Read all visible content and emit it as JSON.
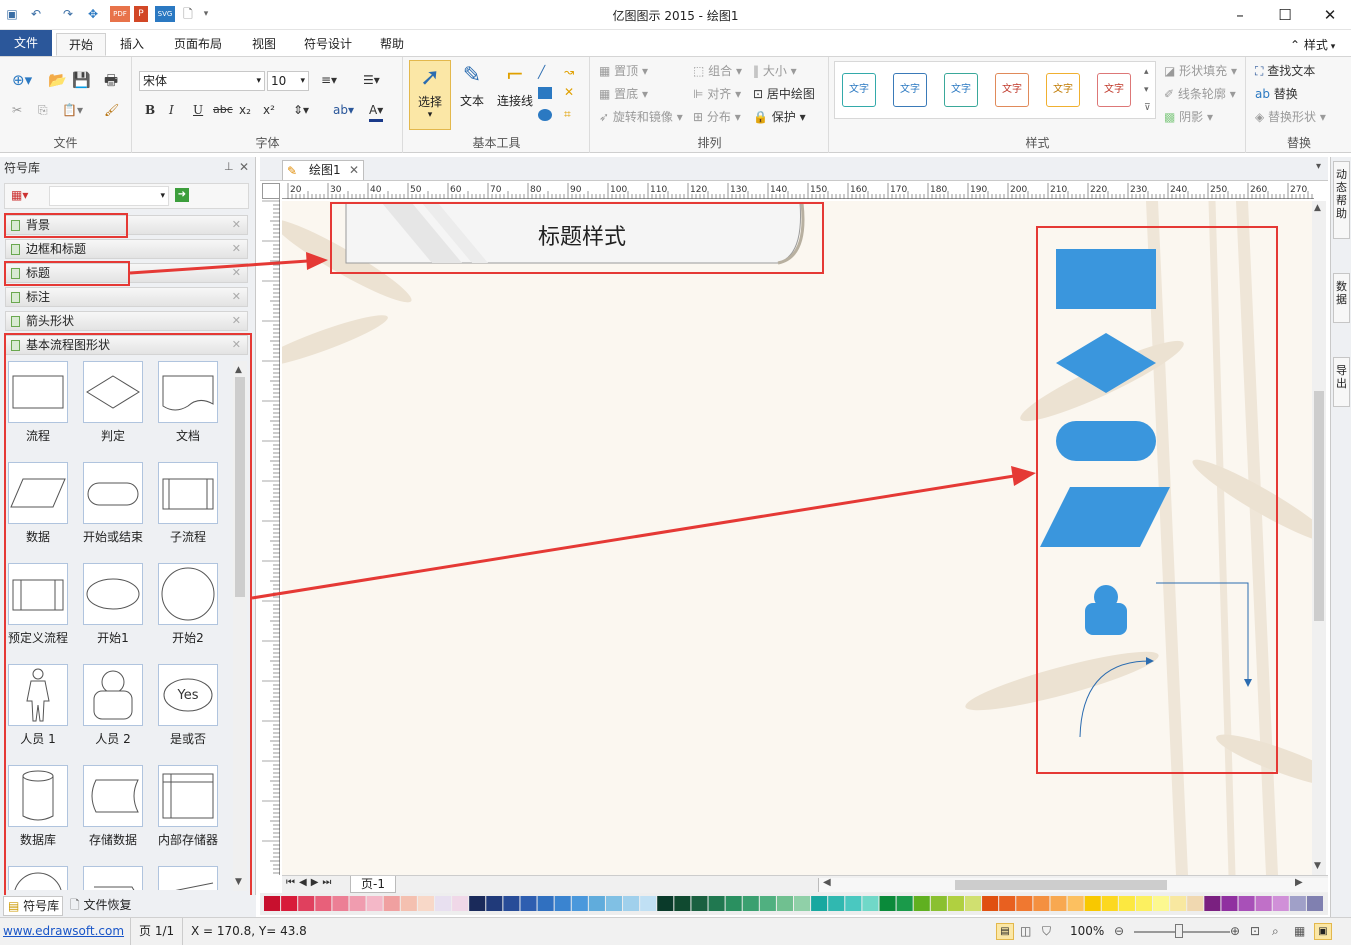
{
  "window": {
    "title": "亿图图示 2015 - 绘图1"
  },
  "quick_access": {
    "pdf": "PDF",
    "ppt": "P",
    "svg": "SVG"
  },
  "tabs": [
    {
      "label": "文件"
    },
    {
      "label": "开始"
    },
    {
      "label": "插入"
    },
    {
      "label": "页面布局"
    },
    {
      "label": "视图"
    },
    {
      "label": "符号设计"
    },
    {
      "label": "帮助"
    }
  ],
  "ribbon_right": {
    "styles_label": "样式"
  },
  "ribbon": {
    "file_group": {
      "label": "文件"
    },
    "font_group": {
      "label": "字体",
      "font_name": "宋体",
      "font_size": "10",
      "bold": "B",
      "italic": "I",
      "underline": "U",
      "strike": "abc",
      "sub": "x₂",
      "sup": "x²",
      "color": "A"
    },
    "tools_group": {
      "label": "基本工具",
      "select": "选择",
      "text": "文本",
      "connector": "连接线"
    },
    "arrange_group": {
      "label": "排列",
      "top": "置顶",
      "bottom": "置底",
      "rotate": "旋转和镜像",
      "group": "组合",
      "align": "对齐",
      "distribute": "分布",
      "size": "大小",
      "center": "居中绘图",
      "protect": "保护"
    },
    "style_group": {
      "label": "样式",
      "sample": "文字",
      "fill": "形状填充",
      "line": "线条轮廓",
      "shadow": "阴影"
    },
    "replace_group": {
      "label": "替换",
      "find": "查找文本",
      "replace": "替换",
      "replace_shape": "替换形状"
    }
  },
  "left_panel": {
    "title": "符号库",
    "categories": [
      {
        "label": "背景"
      },
      {
        "label": "边框和标题"
      },
      {
        "label": "标题"
      },
      {
        "label": "标注"
      },
      {
        "label": "箭头形状"
      },
      {
        "label": "基本流程图形状"
      }
    ],
    "shapes": [
      {
        "label": "流程"
      },
      {
        "label": "判定"
      },
      {
        "label": "文档"
      },
      {
        "label": "数据"
      },
      {
        "label": "开始或结束"
      },
      {
        "label": "子流程"
      },
      {
        "label": "预定义流程"
      },
      {
        "label": "开始1"
      },
      {
        "label": "开始2"
      },
      {
        "label": "人员 1"
      },
      {
        "label": "人员 2"
      },
      {
        "label": "是或否"
      },
      {
        "label": "数据库"
      },
      {
        "label": "存储数据"
      },
      {
        "label": "内部存储器"
      }
    ],
    "yes_text": "Yes",
    "bottom_tabs": [
      {
        "label": "符号库"
      },
      {
        "label": "文件恢复"
      }
    ]
  },
  "document": {
    "tab_label": "绘图1",
    "page_tab": "页-1",
    "title_shape_text": "标题样式"
  },
  "ruler": {
    "h_ticks": [
      "20",
      "30",
      "40",
      "50",
      "60",
      "70",
      "80",
      "90",
      "100",
      "110",
      "120",
      "130",
      "140",
      "150",
      "160",
      "170",
      "180",
      "190",
      "200",
      "210",
      "220",
      "230",
      "240",
      "250",
      "260",
      "270"
    ]
  },
  "right_dock": [
    {
      "label": "动态帮助"
    },
    {
      "label": "数据"
    },
    {
      "label": "导出"
    }
  ],
  "status": {
    "website": "www.edrawsoft.com",
    "page": "页 1/1",
    "coords": "X = 170.8, Y= 43.8",
    "zoom": "100%"
  },
  "colors": {
    "accent": "#2b579a",
    "shape_blue": "#3a96dd",
    "highlight": "#e53935"
  }
}
